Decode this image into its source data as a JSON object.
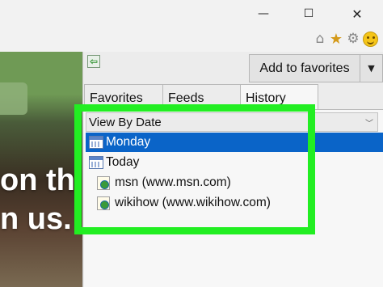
{
  "window": {
    "minimize_glyph": "—",
    "maximize_glyph": "☐",
    "close_glyph": "✕"
  },
  "command_bar": {
    "icons": [
      "home-icon",
      "star-icon",
      "gear-icon",
      "smiley-icon"
    ],
    "home_glyph": "⌂",
    "star_glyph": "★",
    "gear_glyph": "⚙"
  },
  "webpage": {
    "line1": "on th",
    "line2": "n us."
  },
  "favorites_center": {
    "back_glyph": "⇦",
    "add_to_favorites_label": "Add to favorites",
    "dropdown_glyph": "▼",
    "tabs": [
      {
        "label": "Favorites"
      },
      {
        "label": "Feeds"
      },
      {
        "label": "History"
      }
    ],
    "view_select": {
      "value": "View By Date",
      "arrow_glyph": "﹀"
    },
    "history_items": [
      {
        "label": "Monday",
        "icon": "calendar-icon",
        "selected": true
      },
      {
        "label": "Today",
        "icon": "calendar-icon",
        "selected": false
      },
      {
        "label": "msn (www.msn.com)",
        "icon": "webpage-icon",
        "selected": false
      },
      {
        "label": "wikihow (www.wikihow.com)",
        "icon": "webpage-icon",
        "selected": false
      }
    ]
  },
  "colors": {
    "selection": "#0a64c8",
    "highlight_frame": "#22ee22"
  }
}
